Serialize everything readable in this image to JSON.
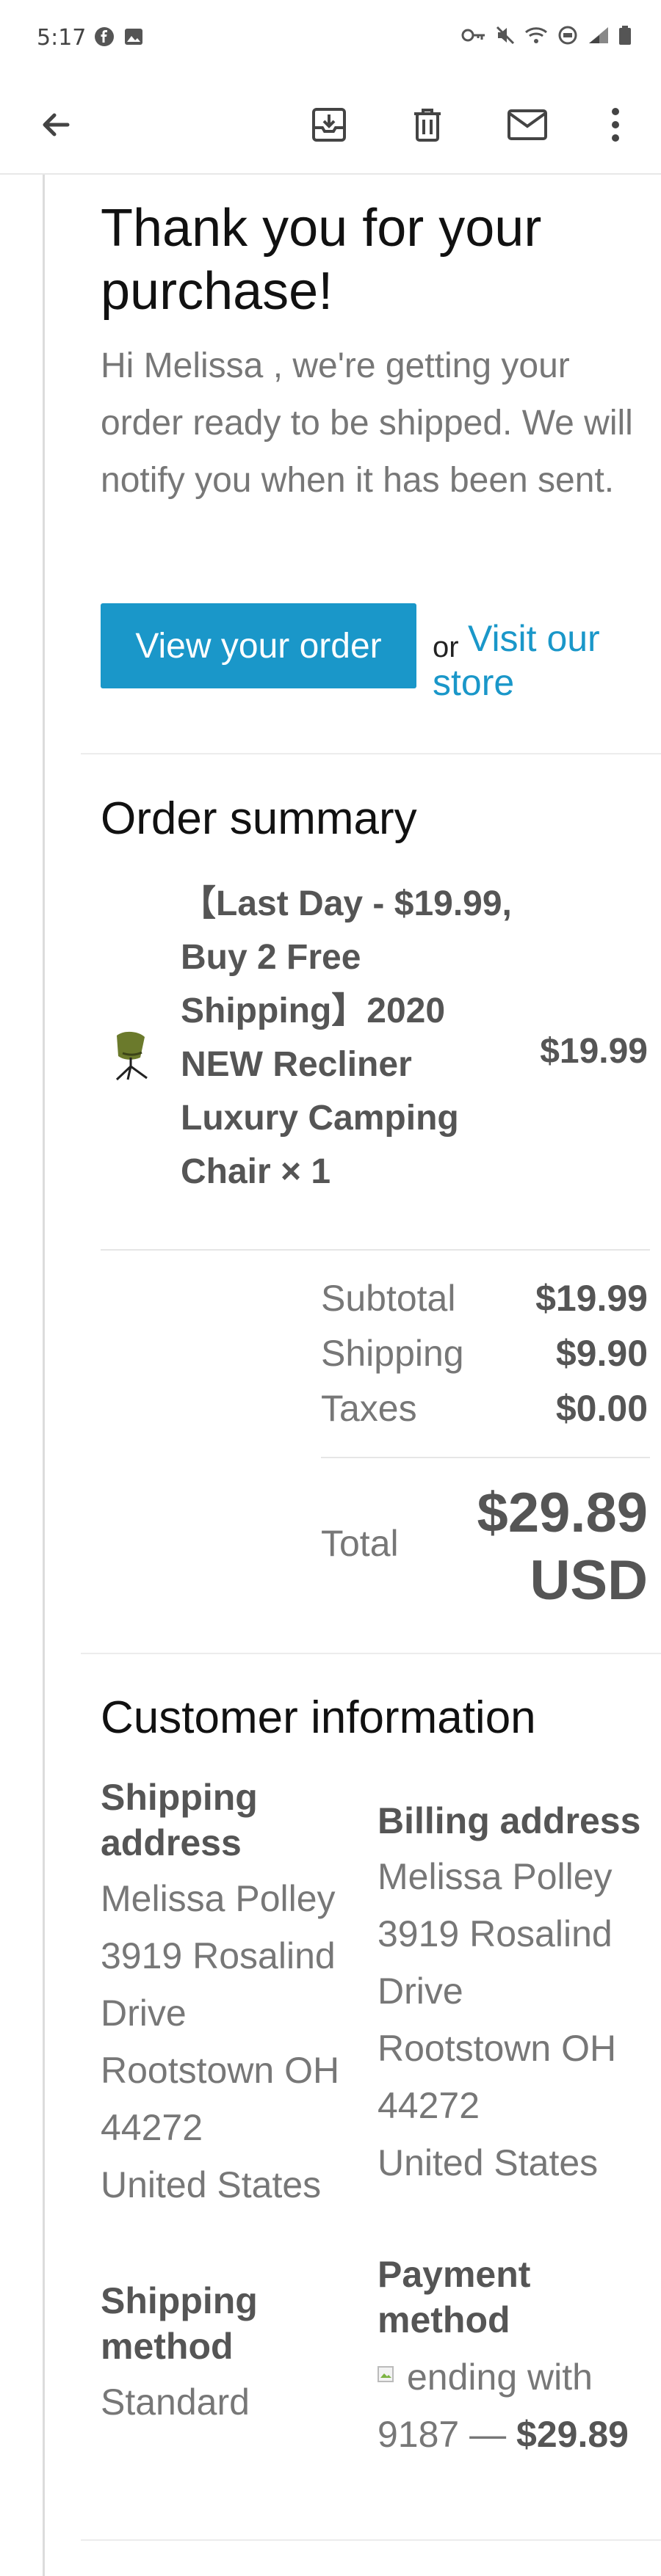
{
  "status_bar": {
    "time": "5:17"
  },
  "toolbar": {
    "back_icon": "arrow-back-icon",
    "archive_icon": "archive-icon",
    "delete_icon": "trash-icon",
    "mark_unread_icon": "mail-icon",
    "more_icon": "more-vertical-icon"
  },
  "email": {
    "heading": "Thank you for your purchase!",
    "intro": "Hi Melissa , we're getting your order ready to be shipped. We will notify you when it has been sent.",
    "view_order_button": "View your order",
    "or_text": "or",
    "visit_store_link": "Visit our store",
    "accent_color": "#1a97c9"
  },
  "order_summary": {
    "heading": "Order summary",
    "item": {
      "title": "【Last Day - $19.99, Buy 2 Free Shipping】2020 NEW Recliner Luxury Camping Chair × 1",
      "price": "$19.99"
    },
    "subtotal_label": "Subtotal",
    "subtotal_value": "$19.99",
    "shipping_label": "Shipping",
    "shipping_value": "$9.90",
    "taxes_label": "Taxes",
    "taxes_value": "$0.00",
    "total_label": "Total",
    "total_value": "$29.89 USD"
  },
  "customer_info": {
    "heading": "Customer information",
    "shipping_address_heading": "Shipping address",
    "shipping_address": [
      "Melissa Polley",
      "3919 Rosalind Drive",
      "Rootstown OH 44272",
      "United States"
    ],
    "billing_address_heading": "Billing address",
    "billing_address": [
      "Melissa Polley",
      "3919 Rosalind Drive",
      "Rootstown OH 44272",
      "United States"
    ],
    "shipping_method_heading": "Shipping method",
    "shipping_method": "Standard",
    "payment_method_heading": "Payment method",
    "payment_text": "ending with 9187 —",
    "payment_amount": "$29.89"
  }
}
